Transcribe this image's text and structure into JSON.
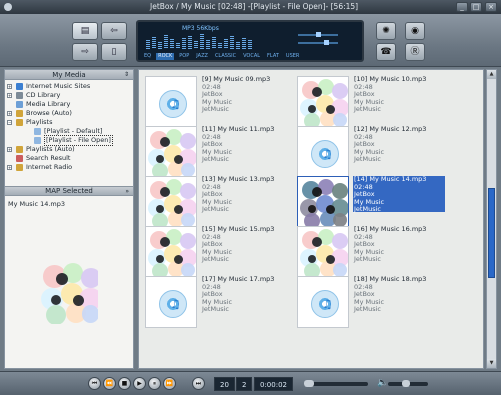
{
  "window": {
    "title": "JetBox / My Music  [02:48]   -[Playlist - File Open]-  [56:15]",
    "controls": [
      "_",
      "□",
      "×"
    ]
  },
  "toolbar": {
    "left_buttons": [
      {
        "name": "view-playlist",
        "icon": "list-icon"
      },
      {
        "name": "view-browse",
        "icon": "back-icon"
      },
      {
        "name": "view-library",
        "icon": "forward-icon"
      },
      {
        "name": "view-device",
        "icon": "device-icon"
      }
    ],
    "right_buttons": [
      {
        "name": "settings",
        "icon": "gear-icon"
      },
      {
        "name": "record",
        "icon": "record-icon"
      },
      {
        "name": "phone",
        "icon": "phone-icon"
      },
      {
        "name": "rating",
        "icon": "r-icon"
      }
    ],
    "lcd": {
      "info": "MP3 56Kbps",
      "eq_label": "EQ",
      "presets": [
        "ROCK",
        "POP",
        "JAZZ",
        "CLASSIC",
        "VOCAL",
        "FLAT",
        "USER"
      ],
      "active_preset": "ROCK"
    }
  },
  "left": {
    "media_header": "My Media",
    "tree": [
      {
        "label": "Internet Music Sites",
        "level": 0,
        "expander": "+",
        "icon_color": "#3b7fd1"
      },
      {
        "label": "CD Library",
        "level": 0,
        "expander": "+",
        "icon_color": "#7c8a97"
      },
      {
        "label": "Media Library",
        "level": 0,
        "expander": "",
        "icon_color": "#6d9fd6"
      },
      {
        "label": "Browse (Auto)",
        "level": 0,
        "expander": "+",
        "icon_color": "#d0a43a"
      },
      {
        "label": "Playlists",
        "level": 0,
        "expander": "−",
        "icon_color": "#d0a43a"
      },
      {
        "label": "[Playlist - Default]",
        "level": 1,
        "expander": "",
        "icon_color": "#8fb6e0"
      },
      {
        "label": "[Playlist - File Open]",
        "level": 1,
        "expander": "",
        "icon_color": "#8fb6e0",
        "selected": true
      },
      {
        "label": "Playlists (Auto)",
        "level": 0,
        "expander": "+",
        "icon_color": "#d0a43a"
      },
      {
        "label": "Search Result",
        "level": 0,
        "expander": "",
        "icon_color": "#cc5d5d"
      },
      {
        "label": "Internet Radio",
        "level": 0,
        "expander": "+",
        "icon_color": "#d0a43a"
      }
    ],
    "selected_header": "Selected",
    "selected_file": "My Music 14.mp3"
  },
  "items": [
    {
      "title": "[9] My Music 09.mp3",
      "duration": "02:48",
      "artist": "JetBox",
      "album": "My Music",
      "genre": "JetMusic",
      "art": "disc"
    },
    {
      "title": "[10] My Music 10.mp3",
      "duration": "02:48",
      "artist": "JetBox",
      "album": "My Music",
      "genre": "JetMusic",
      "art": "flower"
    },
    {
      "title": "[11] My Music 11.mp3",
      "duration": "02:48",
      "artist": "JetBox",
      "album": "My Music",
      "genre": "JetMusic",
      "art": "flower"
    },
    {
      "title": "[12] My Music 12.mp3",
      "duration": "02:48",
      "artist": "JetBox",
      "album": "My Music",
      "genre": "JetMusic",
      "art": "disc"
    },
    {
      "title": "[13] My Music 13.mp3",
      "duration": "02:48",
      "artist": "JetBox",
      "album": "My Music",
      "genre": "JetMusic",
      "art": "flower"
    },
    {
      "title": "[14] My Music 14.mp3",
      "duration": "02:48",
      "artist": "JetBox",
      "album": "My Music",
      "genre": "JetMusic",
      "art": "flower",
      "selected": true
    },
    {
      "title": "[15] My Music 15.mp3",
      "duration": "02:48",
      "artist": "JetBox",
      "album": "My Music",
      "genre": "JetMusic",
      "art": "flower"
    },
    {
      "title": "[16] My Music 16.mp3",
      "duration": "02:48",
      "artist": "JetBox",
      "album": "My Music",
      "genre": "JetMusic",
      "art": "flower"
    },
    {
      "title": "[17] My Music 17.mp3",
      "duration": "02:48",
      "artist": "JetBox",
      "album": "My Music",
      "genre": "JetMusic",
      "art": "disc"
    },
    {
      "title": "[18] My Music 18.mp3",
      "duration": "02:48",
      "artist": "JetBox",
      "album": "My Music",
      "genre": "JetMusic",
      "art": "disc"
    }
  ],
  "player": {
    "buttons": [
      {
        "name": "prev-track",
        "glyph": "⏮"
      },
      {
        "name": "rewind",
        "glyph": "⏪"
      },
      {
        "name": "stop",
        "glyph": "■"
      },
      {
        "name": "play",
        "glyph": "▶"
      },
      {
        "name": "pause",
        "glyph": "⏸"
      },
      {
        "name": "fast-forward",
        "glyph": "⏩"
      },
      {
        "name": "next-track",
        "glyph": "⏭"
      }
    ],
    "total_tracks": "20",
    "current_track": "2",
    "elapsed": "0:00:02",
    "volume_icon": "speaker-icon"
  },
  "colors": {
    "selection": "#3468c2",
    "frame": "#6f7b86"
  }
}
